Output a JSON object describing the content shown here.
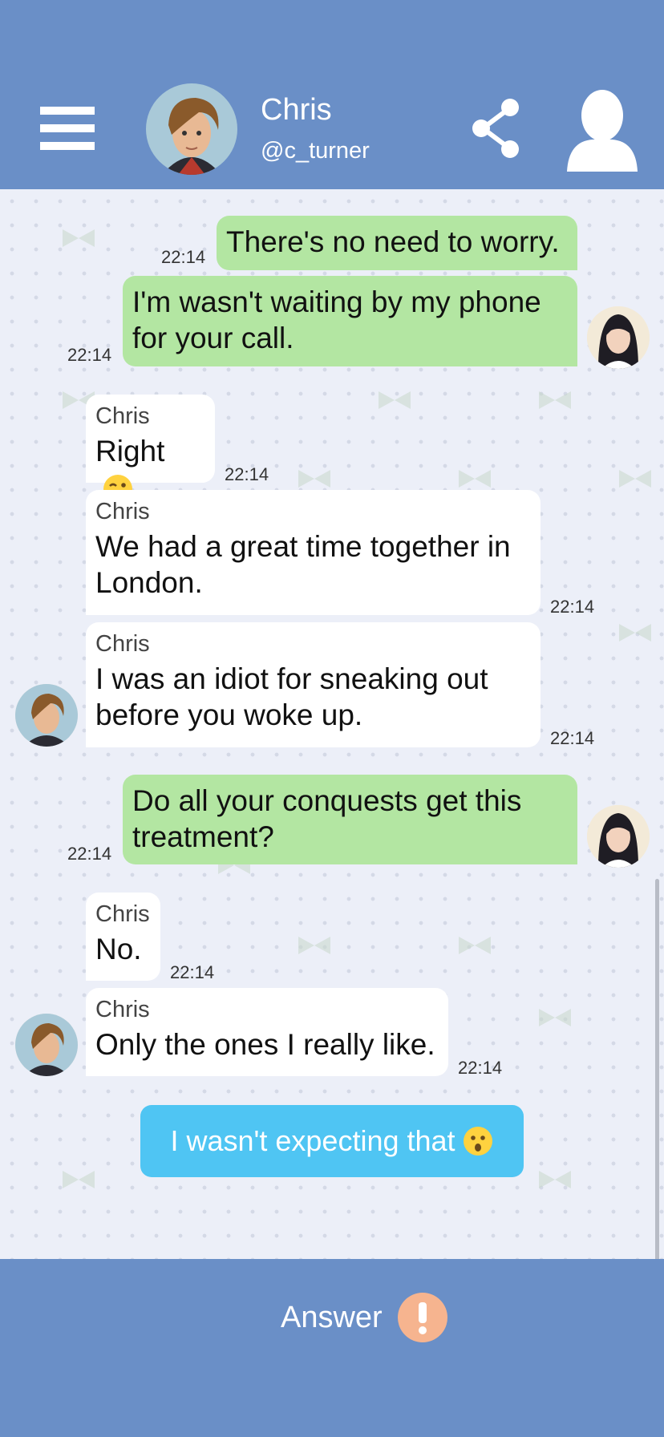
{
  "header": {
    "contact_name": "Chris",
    "contact_handle": "@c_turner",
    "background_color": "#6a8fc7"
  },
  "messages": [
    {
      "from": "me",
      "text": "There's no need to worry.",
      "time": "22:14"
    },
    {
      "from": "me",
      "text": "I'm wasn't waiting by my phone for your call.",
      "time": "22:14"
    },
    {
      "from": "chris",
      "sender": "Chris",
      "text": "Right",
      "emoji": "wink-emoji",
      "time": "22:14"
    },
    {
      "from": "chris",
      "sender": "Chris",
      "text": "We had a great time together in London.",
      "time": "22:14"
    },
    {
      "from": "chris",
      "sender": "Chris",
      "text": "I was an idiot for sneaking out before you woke up.",
      "time": "22:14"
    },
    {
      "from": "me",
      "text": "Do all your conquests get this treatment?",
      "time": "22:14"
    },
    {
      "from": "chris",
      "sender": "Chris",
      "text": "No.",
      "time": "22:14"
    },
    {
      "from": "chris",
      "sender": "Chris",
      "text": "Only the ones I really like.",
      "time": "22:14"
    }
  ],
  "choice": {
    "text": "I wasn't expecting that",
    "emoji": "surprised-emoji",
    "color": "#4fc5f3"
  },
  "footer": {
    "answer_label": "Answer",
    "alert_color": "#f6b48f"
  },
  "colors": {
    "outgoing_bubble": "#b3e6a2",
    "incoming_bubble": "#ffffff",
    "chat_background": "#eceff8"
  }
}
